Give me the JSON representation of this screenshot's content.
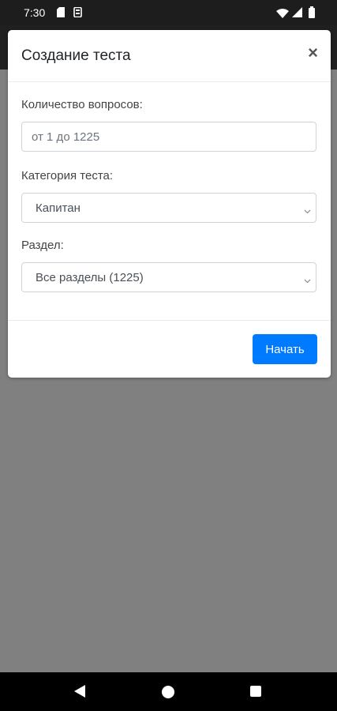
{
  "status_bar": {
    "time": "7:30",
    "icons": [
      "sim-card-icon",
      "storage-icon",
      "wifi-icon",
      "signal-icon",
      "battery-icon"
    ]
  },
  "modal": {
    "title": "Создание теста",
    "close_label": "×",
    "question_count": {
      "label": "Количество вопросов:",
      "placeholder": "от 1 до 1225",
      "value": ""
    },
    "category": {
      "label": "Категория теста:",
      "selected": "Капитан"
    },
    "section": {
      "label": "Раздел:",
      "selected": "Все разделы (1225)"
    },
    "start_button": "Начать"
  },
  "colors": {
    "primary": "#007bff",
    "overlay": "#808080",
    "status_bar": "#1d1d1d"
  }
}
